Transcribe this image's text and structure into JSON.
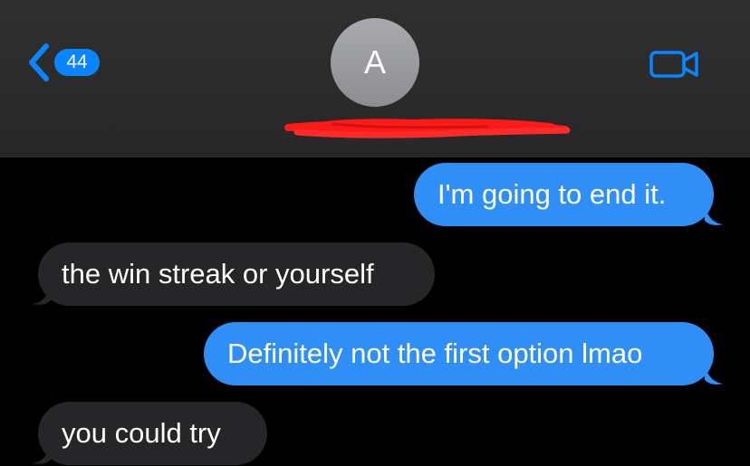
{
  "header": {
    "back_badge_count": "44",
    "contact_initial": "A",
    "colors": {
      "accent": "#0a84ff",
      "header_bg": "#2b2c2b",
      "redaction": "#ff1a1a"
    },
    "icons": [
      "chevron-left-icon",
      "video-camera-icon"
    ]
  },
  "messages": [
    {
      "direction": "sent",
      "text": "I'm going to end it."
    },
    {
      "direction": "received",
      "text": "the win streak or yourself"
    },
    {
      "direction": "sent",
      "text": "Definitely not the first option lmao"
    },
    {
      "direction": "received",
      "text": "you could try"
    }
  ],
  "colors": {
    "sent_bubble": "#2f8ff7",
    "received_bubble": "#262628",
    "background": "#000000"
  }
}
